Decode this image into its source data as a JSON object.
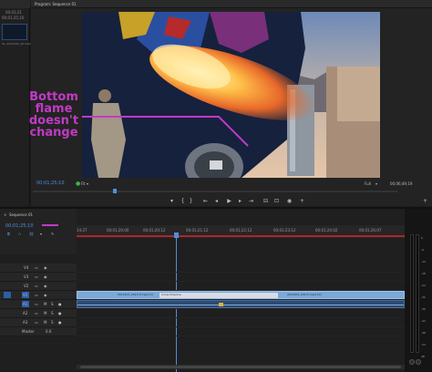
{
  "program": {
    "title": "Program: Sequence 01",
    "timecode": "00;01;25;10",
    "fit_label": "Fit",
    "zoom_label": "Full",
    "duration": "00;06;49;19",
    "annotation_lines": [
      "Bottom",
      "flame",
      "doesn't",
      "change"
    ]
  },
  "source": {
    "title_line": "",
    "file_labels": [
      "00;01;21",
      "00;01;25;10",
      "01_2012103_16.mp4"
    ]
  },
  "timeline": {
    "tab_label": "Sequence 01",
    "timecode": "00;01;25;10",
    "ruler_ticks": [
      "14;27",
      "00;01;20;00",
      "00;01;20;12",
      "00;01;21;12",
      "00;01;22;12",
      "00;01;23;12",
      "00;01;24;02",
      "00;01;26;07"
    ],
    "clip_v1": "2012103_2017r9.mp4 [V]",
    "clip_v1_b": "Cross Dissolve",
    "clip_v1_c": "2012103_2017h.mp4 [V]",
    "master_label": "Master",
    "master_value": "0.0",
    "track_names": [
      "V4",
      "V3",
      "V2",
      "V1",
      "A1",
      "A2",
      "A3"
    ],
    "vu_marks": [
      "0",
      "-6",
      "-12",
      "-18",
      "-24",
      "-30",
      "-36",
      "-42",
      "-48",
      "-54",
      "dB"
    ]
  },
  "colors": {
    "annotation": "#c23ac6",
    "accent_blue": "#4f8fe0",
    "clip_video": "#7aa8d8",
    "clip_audio": "#2d4b74",
    "playhead": "#4f8fe0"
  }
}
